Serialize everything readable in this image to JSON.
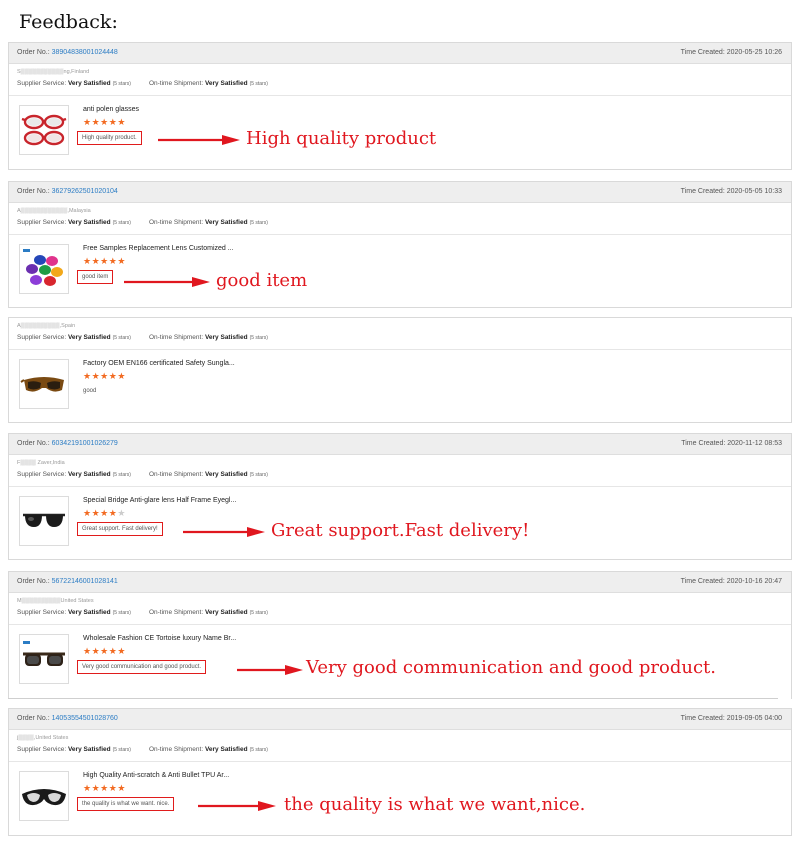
{
  "title": "Feedback:",
  "labels": {
    "order_no": "Order No.: ",
    "time_created": "Time Created: ",
    "supplier_service": "Supplier Service: ",
    "ontime_shipment": "On-time Shipment: ",
    "rating_text": "Very Satisfied",
    "stars_note": "(5 stars)"
  },
  "colors": {
    "accent_red": "#e0171f",
    "star_orange": "#f26a21",
    "link_blue": "#2b7cc4"
  },
  "reviews": [
    {
      "order_no": "38904838001024448",
      "time": "2020-05-25 10:26",
      "buyer": "S▒▒▒▒▒▒▒▒▒▒▒ng,Finland",
      "product": "anti polen glasses",
      "stars": 5,
      "comment": "High quality product.",
      "annotation": "High quality product",
      "thumb_icon": "red-frame-glasses-icon"
    },
    {
      "order_no": "36279262501020104",
      "time": "2020-05-05 10:33",
      "buyer": "A▒▒▒▒▒▒▒▒▒▒▒▒,Malaysia",
      "product": "Free Samples Replacement Lens Customized ...",
      "stars": 5,
      "comment": "good item",
      "annotation": "good item",
      "thumb_icon": "colored-lenses-icon"
    },
    {
      "buyer": "A▒▒▒▒▒▒▒▒▒▒,Spain",
      "product": "Factory OEM EN166 certificated Safety Sungla...",
      "stars": 5,
      "comment": "good",
      "thumb_icon": "safety-sunglasses-icon"
    },
    {
      "order_no": "60342191001026279",
      "time": "2020-11-12 08:53",
      "buyer": "F▒▒▒▒ Zaver,India",
      "product": "Special Bridge Anti-glare lens Half Frame Eyegl...",
      "stars": 4,
      "comment": "Great support. Fast delivery!",
      "annotation": "Great support.Fast delivery!",
      "thumb_icon": "half-frame-sunglasses-icon"
    },
    {
      "order_no": "56722146001028141",
      "time": "2020-10-16 20:47",
      "buyer": "M▒▒▒▒▒▒▒▒▒▒United States",
      "product": "Wholesale Fashion CE Tortoise luxury Name Br...",
      "stars": 5,
      "comment": "Very good communication and good product.",
      "annotation": "Very good communication and good product.",
      "thumb_icon": "tortoise-sunglasses-icon"
    },
    {
      "order_no": "14053554501028760",
      "time": "2019-09-05 04:00",
      "buyer": "j▒▒▒▒,United States",
      "product": "High Quality Anti-scratch & Anti Bullet TPU Ar...",
      "stars": 5,
      "comment": "the quality is what we want.  nice.",
      "annotation": "the quality is what we want,nice.",
      "thumb_icon": "sport-goggles-icon"
    }
  ]
}
